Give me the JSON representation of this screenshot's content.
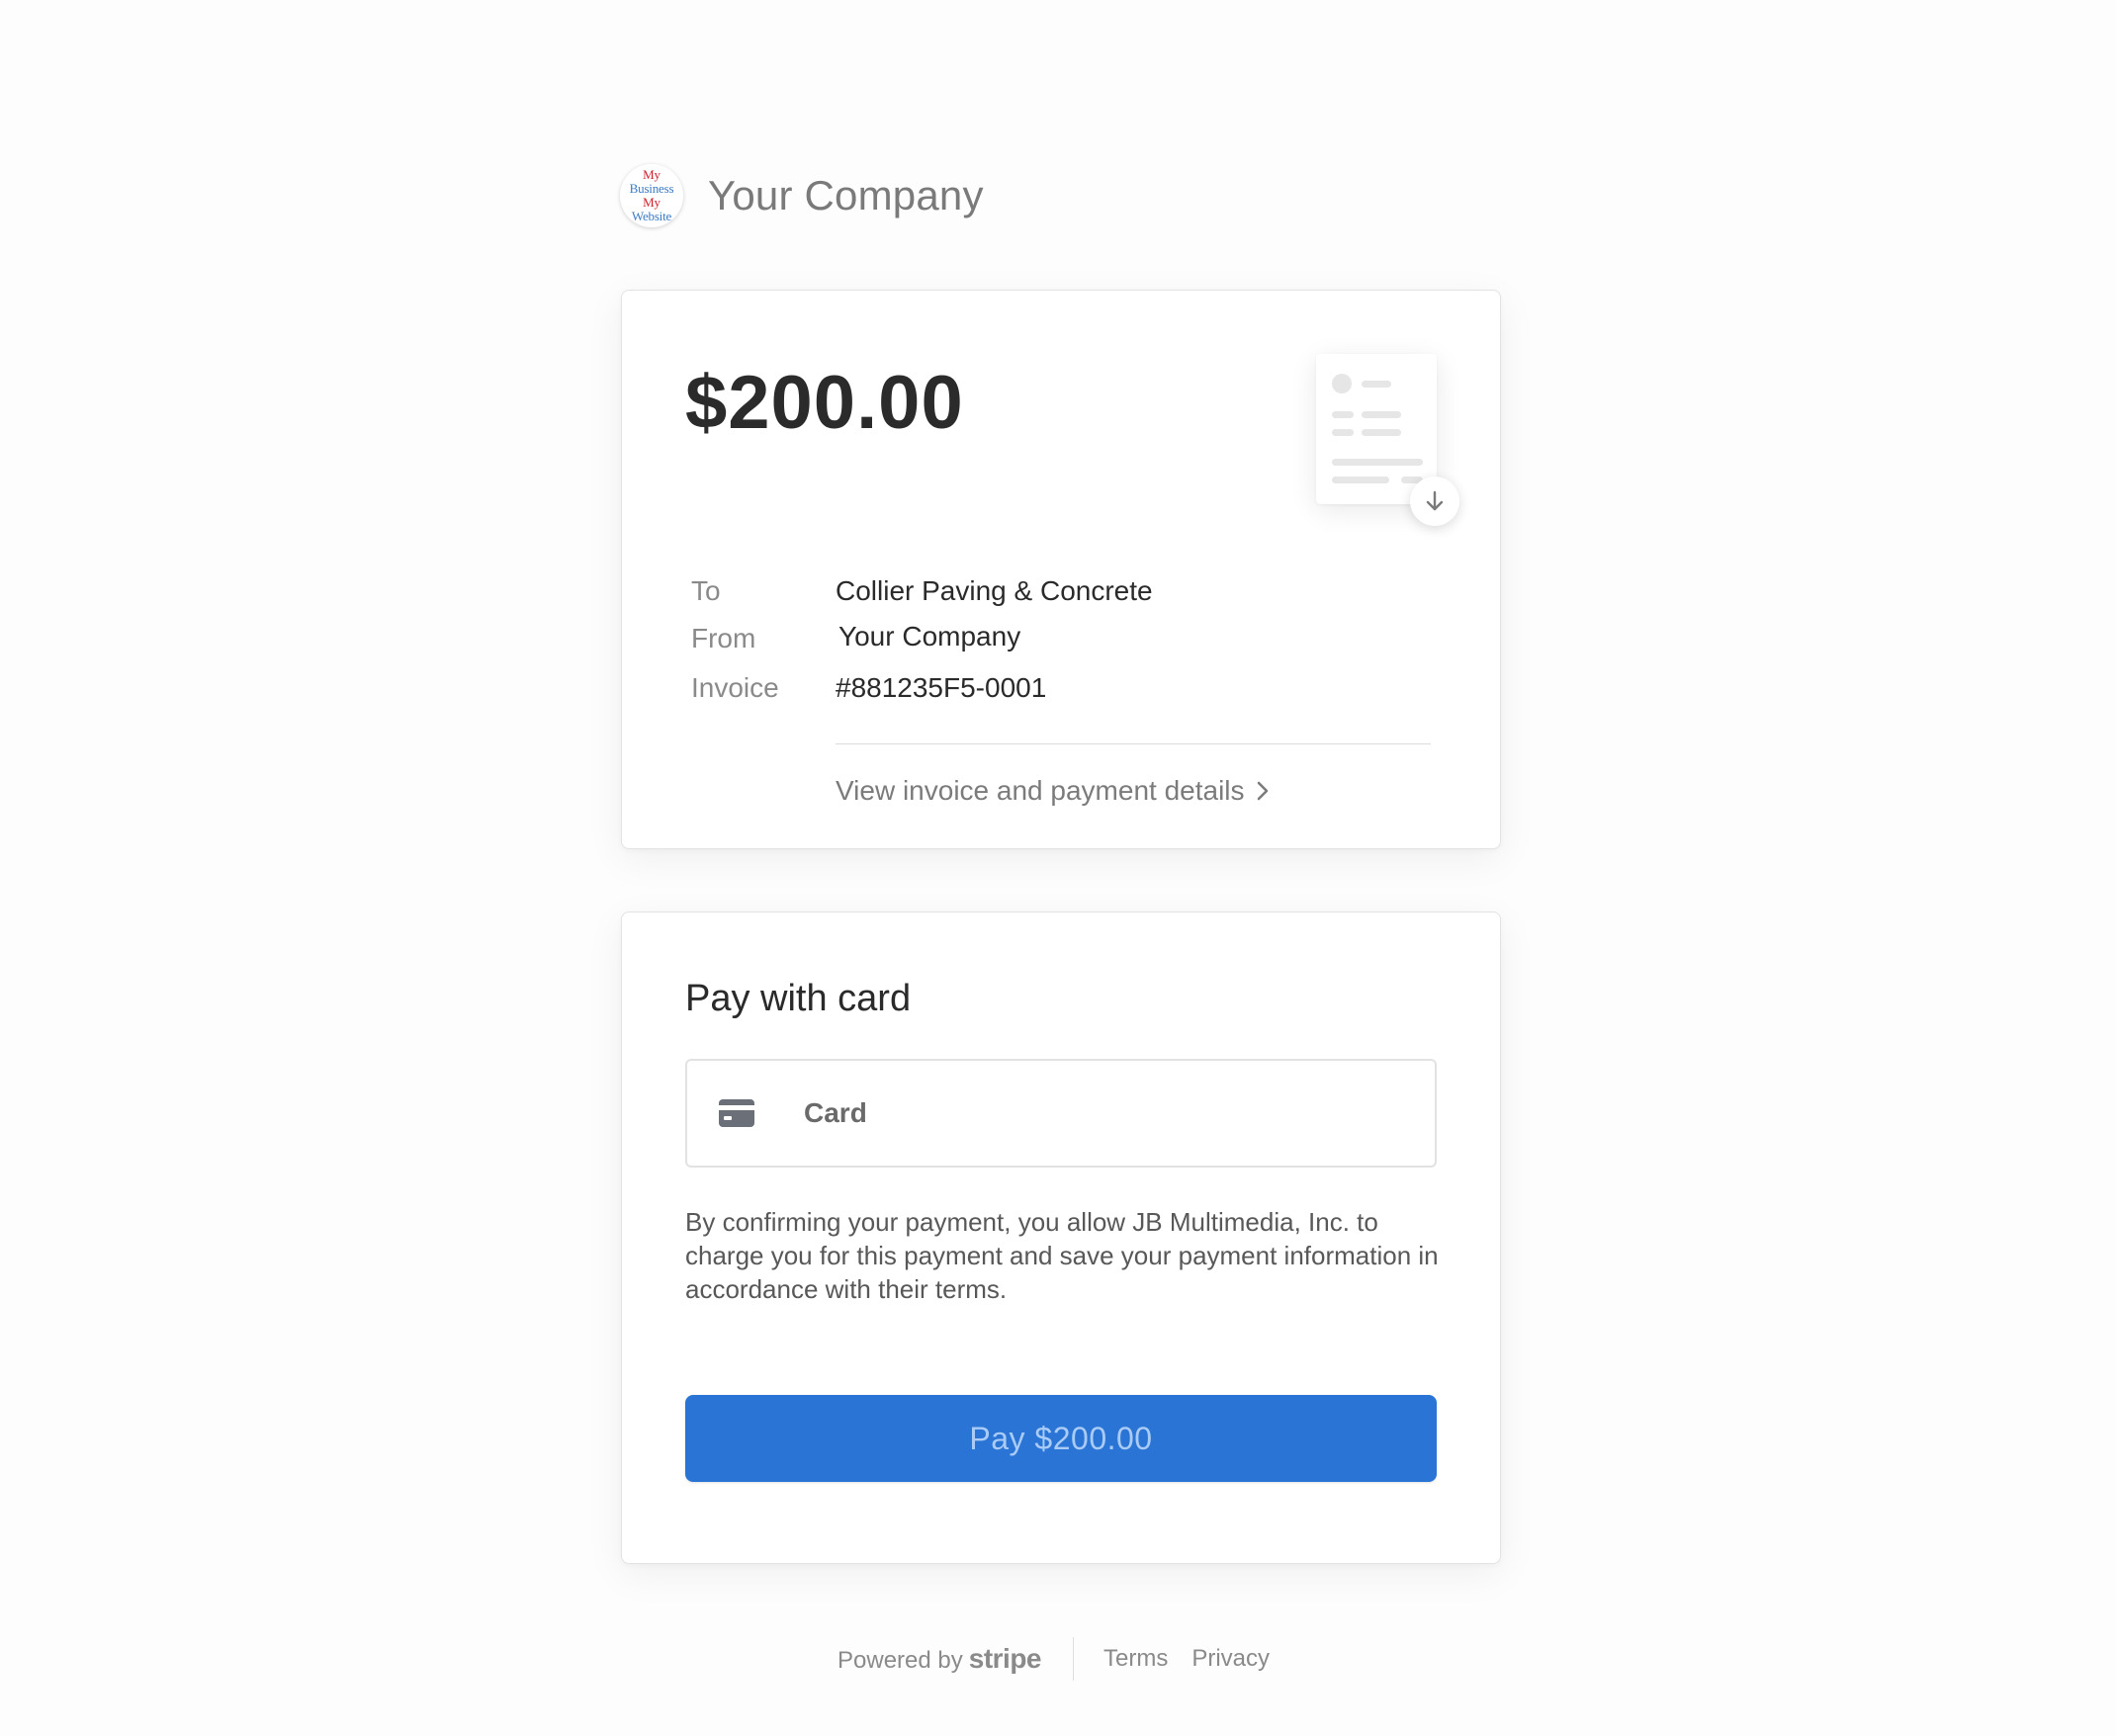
{
  "header": {
    "logo_lines": [
      "My",
      "Business",
      "My",
      "Website"
    ],
    "company_name": "Your Company"
  },
  "invoice": {
    "amount": "$200.00",
    "details": [
      {
        "label": "To",
        "value": "Collier Paving & Concrete"
      },
      {
        "label": "From",
        "value": "Your Company"
      },
      {
        "label": "Invoice",
        "value": "#881235F5-0001"
      }
    ],
    "view_link": "View invoice and payment details",
    "download_icon": "arrow-down-icon"
  },
  "payment": {
    "title": "Pay with card",
    "method_label": "Card",
    "method_icon": "credit-card-icon",
    "consent": "By confirming your payment, you allow JB Multimedia, Inc. to charge you for this payment and save your payment information in accordance with their terms.",
    "button_label": "Pay $200.00"
  },
  "footer": {
    "powered_by": "Powered by",
    "brand": "stripe",
    "terms": "Terms",
    "privacy": "Privacy"
  },
  "colors": {
    "accent": "#2a74d5",
    "button_text": "#a9cbf5",
    "muted_text": "#8a8a8a",
    "logo_red": "#d0202a",
    "logo_blue": "#3b7bc4"
  }
}
